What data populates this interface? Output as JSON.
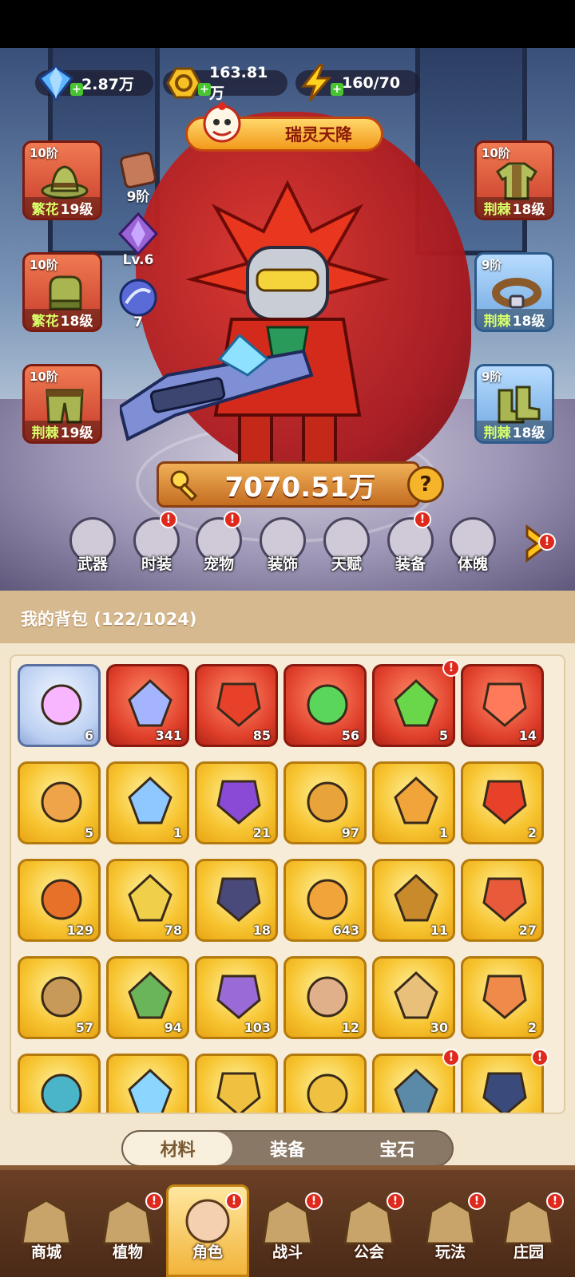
{
  "currencies": [
    {
      "name": "diamond",
      "value": "2.87万",
      "icon": "diamond-icon"
    },
    {
      "name": "gold",
      "value": "163.81万",
      "icon": "gold-coin-icon"
    },
    {
      "name": "energy",
      "value": "160/70",
      "icon": "lightning-icon"
    }
  ],
  "banner": {
    "label": "瑞灵天降"
  },
  "left_slots": [
    {
      "tier": "10阶",
      "prefix": "繁花",
      "level": "19级"
    },
    {
      "tier": "10阶",
      "prefix": "繁花",
      "level": "18级"
    },
    {
      "tier": "10阶",
      "prefix": "荆棘",
      "level": "19级"
    }
  ],
  "right_slots": [
    {
      "tier": "10阶",
      "prefix": "荆棘",
      "level": "18级"
    },
    {
      "tier": "9阶",
      "prefix": "荆棘",
      "level": "18级"
    },
    {
      "tier": "9阶",
      "prefix": "荆棘",
      "level": "18级"
    }
  ],
  "side_stats": {
    "tier": "9阶",
    "level": "Lv.6",
    "count": "7"
  },
  "power": "7070.51万",
  "help": "?",
  "features": [
    "武器",
    "时装",
    "宠物",
    "装饰",
    "天赋",
    "装备",
    "体魄"
  ],
  "bag": {
    "title": "我的背包 (122/1024)",
    "items": [
      {
        "count": "6",
        "rarity": "blue"
      },
      {
        "count": "341",
        "rarity": "red"
      },
      {
        "count": "85",
        "rarity": "red"
      },
      {
        "count": "56",
        "rarity": "red"
      },
      {
        "count": "5",
        "rarity": "red"
      },
      {
        "count": "14",
        "rarity": "red"
      },
      {
        "count": "5",
        "rarity": "gold"
      },
      {
        "count": "1",
        "rarity": "gold"
      },
      {
        "count": "21",
        "rarity": "gold"
      },
      {
        "count": "97",
        "rarity": "gold"
      },
      {
        "count": "1",
        "rarity": "gold"
      },
      {
        "count": "2",
        "rarity": "gold"
      },
      {
        "count": "129",
        "rarity": "gold"
      },
      {
        "count": "78",
        "rarity": "gold"
      },
      {
        "count": "18",
        "rarity": "gold"
      },
      {
        "count": "643",
        "rarity": "gold"
      },
      {
        "count": "11",
        "rarity": "gold"
      },
      {
        "count": "27",
        "rarity": "gold"
      },
      {
        "count": "57",
        "rarity": "gold"
      },
      {
        "count": "94",
        "rarity": "gold"
      },
      {
        "count": "103",
        "rarity": "gold"
      },
      {
        "count": "12",
        "rarity": "gold"
      },
      {
        "count": "30",
        "rarity": "gold"
      },
      {
        "count": "2",
        "rarity": "gold"
      },
      {
        "count": "",
        "rarity": "gold"
      },
      {
        "count": "",
        "rarity": "gold"
      },
      {
        "count": "",
        "rarity": "gold"
      },
      {
        "count": "",
        "rarity": "gold"
      },
      {
        "count": "",
        "rarity": "gold"
      },
      {
        "count": "",
        "rarity": "gold"
      }
    ]
  },
  "tabs": [
    {
      "label": "材料",
      "active": true
    },
    {
      "label": "装备",
      "active": false
    },
    {
      "label": "宝石",
      "active": false
    }
  ],
  "nav": [
    {
      "label": "商城"
    },
    {
      "label": "植物"
    },
    {
      "label": "角色",
      "active": true
    },
    {
      "label": "战斗"
    },
    {
      "label": "公会"
    },
    {
      "label": "玩法"
    },
    {
      "label": "庄园"
    }
  ],
  "colors": {
    "accent": "#f2b43a",
    "alert": "#e0291d",
    "level_green": "#d8ff6a"
  }
}
